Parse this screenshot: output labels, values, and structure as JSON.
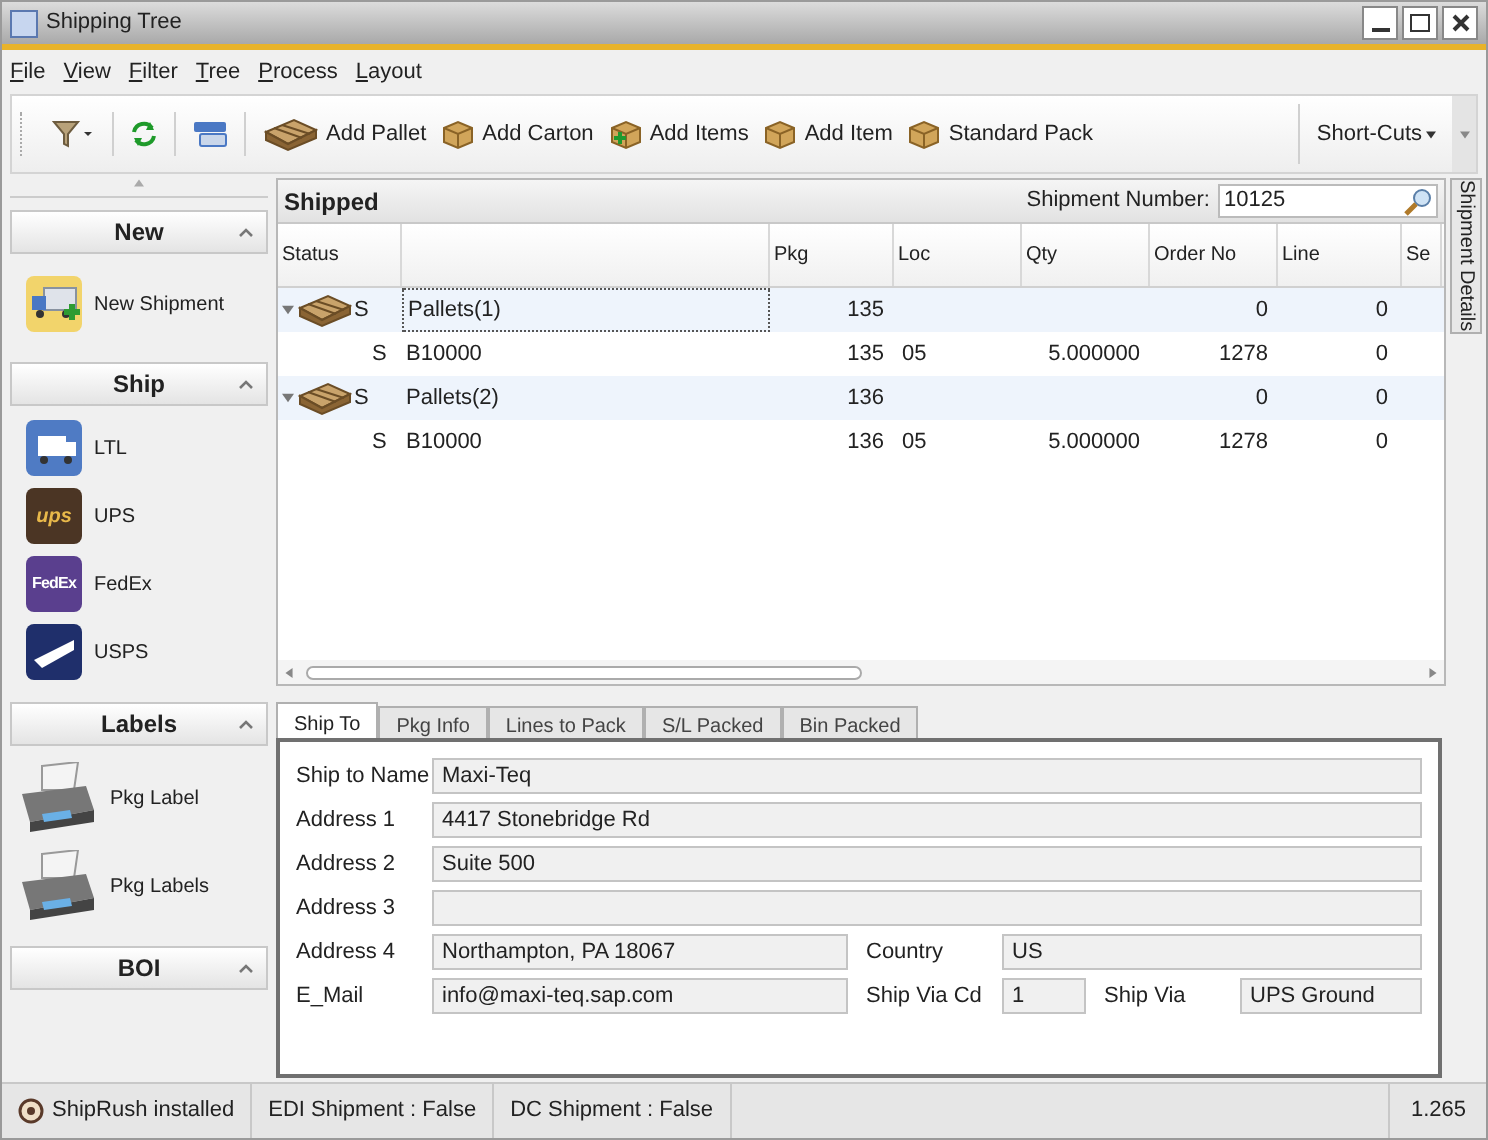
{
  "window": {
    "title": "Shipping Tree"
  },
  "menu": [
    {
      "label": "File"
    },
    {
      "label": "View"
    },
    {
      "label": "Filter"
    },
    {
      "label": "Tree"
    },
    {
      "label": "Process"
    },
    {
      "label": "Layout"
    }
  ],
  "toolbar": {
    "items": [
      {
        "kind": "filter"
      },
      {
        "kind": "refresh"
      },
      {
        "kind": "form"
      },
      {
        "kind": "pallet",
        "label": "Add Pallet"
      },
      {
        "kind": "carton",
        "label": "Add Carton"
      },
      {
        "kind": "items",
        "label": "Add Items"
      },
      {
        "kind": "item",
        "label": "Add Item"
      },
      {
        "kind": "pack",
        "label": "Standard Pack"
      }
    ],
    "shortcuts": "Short-Cuts"
  },
  "sidebar": {
    "groups": [
      {
        "title": "New",
        "expanded": true,
        "items": [
          {
            "kind": "new",
            "label": "New Shipment"
          }
        ]
      },
      {
        "title": "Ship",
        "expanded": true,
        "items": [
          {
            "kind": "ltl",
            "label": "LTL"
          },
          {
            "kind": "ups",
            "label": "UPS",
            "mark": "ups"
          },
          {
            "kind": "fedex",
            "label": "FedEx",
            "mark": "FedEx"
          },
          {
            "kind": "usps",
            "label": "USPS"
          }
        ]
      },
      {
        "title": "Labels",
        "expanded": true,
        "items": [
          {
            "kind": "printer",
            "label": "Pkg Label"
          },
          {
            "kind": "printer",
            "label": "Pkg Labels"
          }
        ]
      },
      {
        "title": "BOI",
        "expanded": true
      }
    ]
  },
  "grid": {
    "title": "Shipped",
    "search_label": "Shipment Number:",
    "search_value": "10125",
    "columns": [
      "Status",
      "",
      "Pkg",
      "Loc",
      "Qty",
      "Order No",
      "Line",
      "Se"
    ],
    "rows": [
      {
        "expanded": true,
        "focused": true,
        "status": "S",
        "name": "Pallets(1)",
        "pkg": "135",
        "loc": "",
        "qty": "",
        "order_no": "0",
        "line": "0",
        "children": [
          {
            "status": "S",
            "name": "B10000",
            "pkg": "135",
            "loc": "05",
            "qty": "5.000000",
            "order_no": "1278",
            "line": "0"
          }
        ]
      },
      {
        "expanded": true,
        "focused": false,
        "status": "S",
        "name": "Pallets(2)",
        "pkg": "136",
        "loc": "",
        "qty": "",
        "order_no": "0",
        "line": "0",
        "children": [
          {
            "status": "S",
            "name": "B10000",
            "pkg": "136",
            "loc": "05",
            "qty": "5.000000",
            "order_no": "1278",
            "line": "0"
          }
        ]
      }
    ]
  },
  "side_tab": "Shipment Details",
  "detail_tabs": [
    {
      "label": "Ship To",
      "selected": true
    },
    {
      "label": "Pkg Info",
      "selected": false
    },
    {
      "label": "Lines to Pack",
      "selected": false
    },
    {
      "label": "S/L Packed",
      "selected": false
    },
    {
      "label": "Bin Packed",
      "selected": false
    }
  ],
  "form_rows": [
    [
      {
        "label": "Ship to Name",
        "value": "Maxi-Teq"
      }
    ],
    [
      {
        "label": "Address 1",
        "value": "4417 Stonebridge Rd"
      }
    ],
    [
      {
        "label": "Address 2",
        "value": "Suite 500"
      }
    ],
    [
      {
        "label": "Address 3"
      }
    ],
    [
      {
        "label": "Address 4",
        "value": "Northampton, PA  18067"
      },
      {
        "label": "Country",
        "value": "US"
      }
    ],
    [
      {
        "label": "E_Mail",
        "value": "info@maxi-teq.sap.com"
      },
      {
        "label": "Ship Via Cd",
        "value": "1"
      },
      {
        "label": "Ship Via",
        "value": "UPS Ground"
      }
    ]
  ],
  "status_bar": {
    "items": [
      {
        "kind": "icon",
        "label": "ShipRush installed"
      },
      {
        "kind": "text",
        "label": "EDI Shipment : False"
      },
      {
        "kind": "text",
        "label": "DC Shipment : False"
      }
    ],
    "version": "1.265"
  }
}
